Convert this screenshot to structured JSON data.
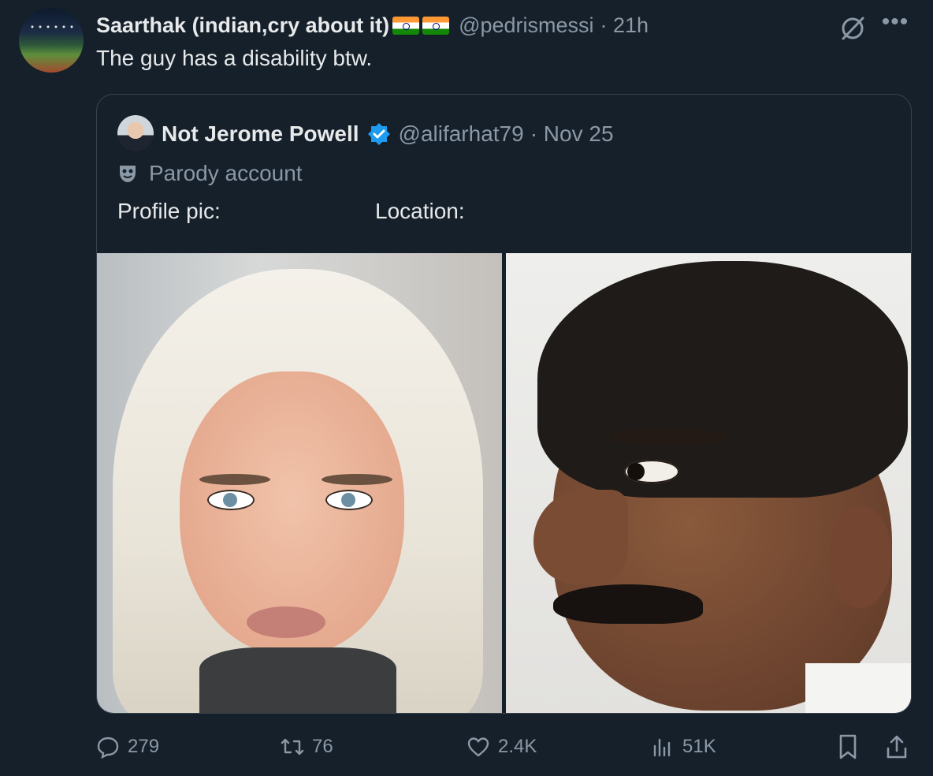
{
  "tweet": {
    "author_name": "Saarthak (indian,cry about it)",
    "flags": [
      "india-flag",
      "india-flag"
    ],
    "handle": "@pedrismessi",
    "time": "· 21h",
    "text": "The guy has a disability btw."
  },
  "quoted": {
    "name": "Not Jerome Powell",
    "handle": "@alifarhat79",
    "date": "· Nov 25",
    "label": "Parody account",
    "line_left": "Profile pic:",
    "line_right": "Location:",
    "images": [
      "blonde-woman-portrait",
      "man-with-mustache-profile"
    ]
  },
  "actions": {
    "replies": "279",
    "reposts": "76",
    "likes": "2.4K",
    "views": "51K"
  },
  "colors": {
    "background": "#15202b",
    "secondary_text": "#8b98a5",
    "verified": "#1d9bf0",
    "border": "#38444d"
  }
}
